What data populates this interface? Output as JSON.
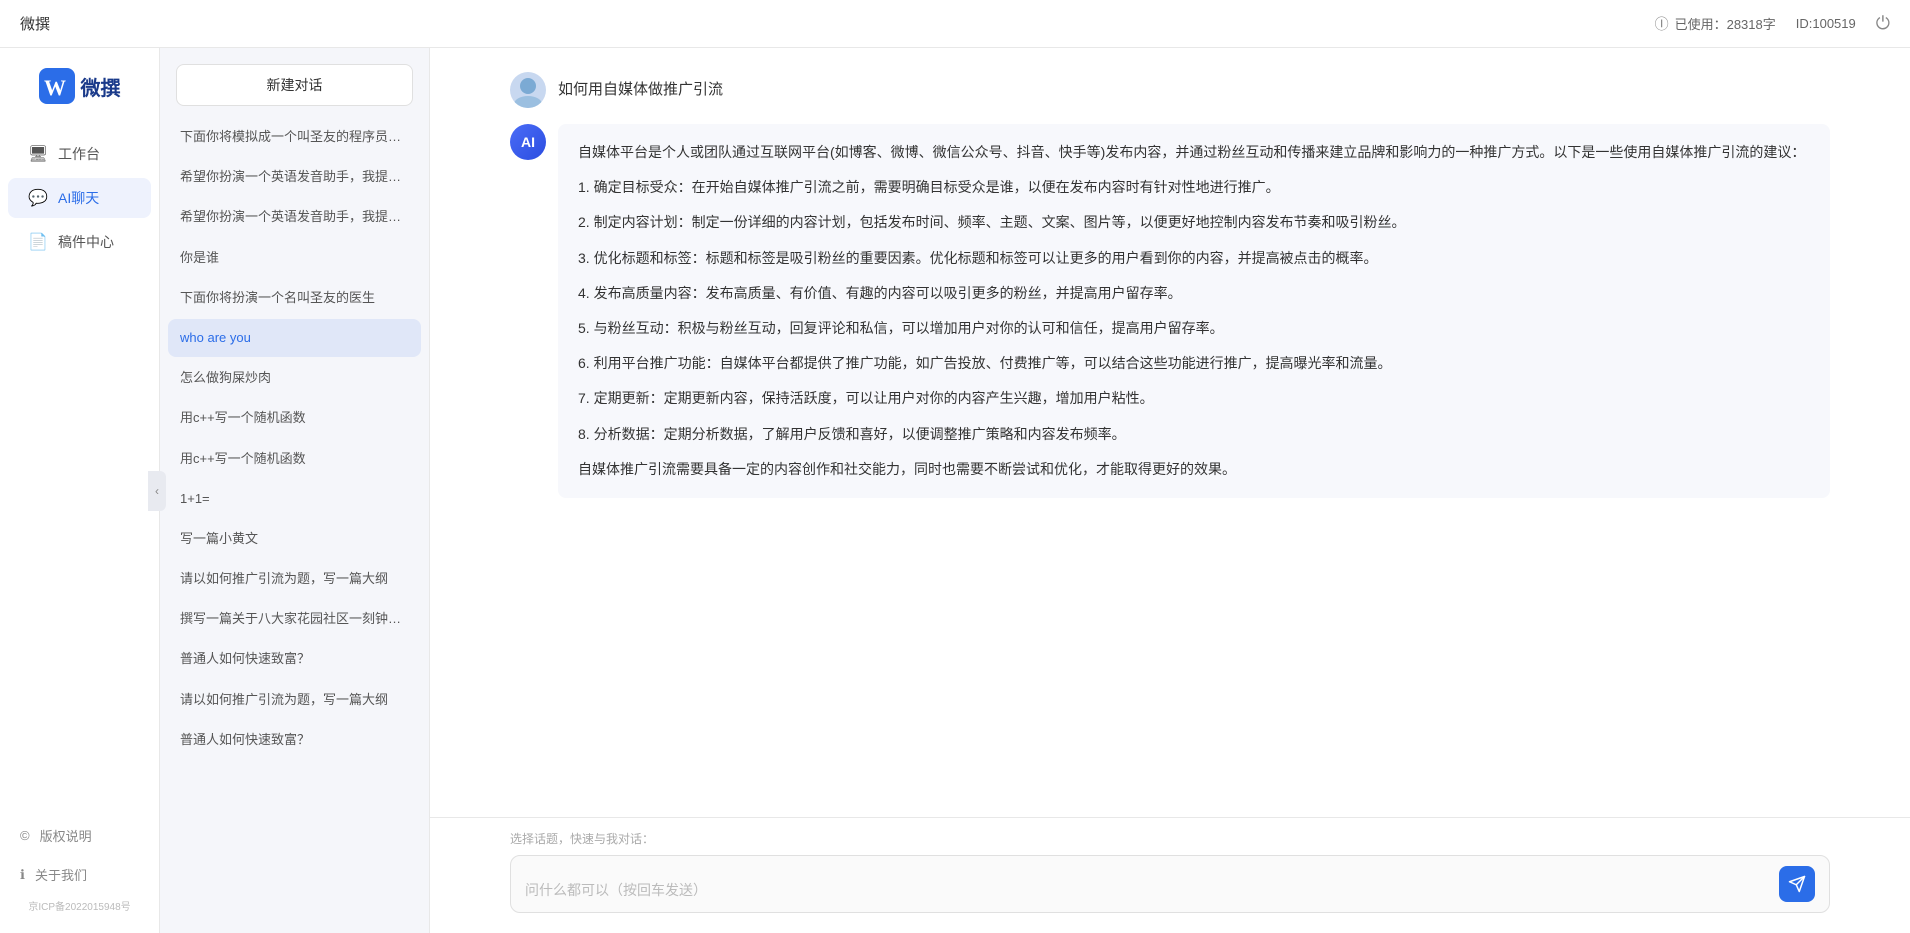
{
  "topbar": {
    "title": "微撰",
    "usage_label": "已使用：28318字",
    "id_label": "ID:100519",
    "logout_icon": "⏻"
  },
  "sidebar": {
    "logo_text": "微撰",
    "nav_items": [
      {
        "id": "workbench",
        "label": "工作台",
        "icon": "🖥"
      },
      {
        "id": "ai-chat",
        "label": "AI聊天",
        "icon": "💬",
        "active": true
      },
      {
        "id": "drafts",
        "label": "稿件中心",
        "icon": "📄"
      }
    ],
    "bottom_items": [
      {
        "id": "copyright",
        "label": "版权说明",
        "icon": "©"
      },
      {
        "id": "about",
        "label": "关于我们",
        "icon": "ℹ"
      }
    ],
    "icp": "京ICP备2022015948号"
  },
  "chat_list": {
    "new_chat_label": "新建对话",
    "items": [
      {
        "id": "c1",
        "text": "下面你将模拟成一个叫圣友的程序员，我说..."
      },
      {
        "id": "c2",
        "text": "希望你扮演一个英语发音助手，我提供给你..."
      },
      {
        "id": "c3",
        "text": "希望你扮演一个英语发音助手，我提供给你..."
      },
      {
        "id": "c4",
        "text": "你是谁"
      },
      {
        "id": "c5",
        "text": "下面你将扮演一个名叫圣友的医生"
      },
      {
        "id": "c6",
        "text": "who are you",
        "active": true
      },
      {
        "id": "c7",
        "text": "怎么做狗屎炒肉"
      },
      {
        "id": "c8",
        "text": "用c++写一个随机函数"
      },
      {
        "id": "c9",
        "text": "用c++写一个随机函数"
      },
      {
        "id": "c10",
        "text": "1+1="
      },
      {
        "id": "c11",
        "text": "写一篇小黄文"
      },
      {
        "id": "c12",
        "text": "请以如何推广引流为题，写一篇大纲"
      },
      {
        "id": "c13",
        "text": "撰写一篇关于八大家花园社区一刻钟便民生..."
      },
      {
        "id": "c14",
        "text": "普通人如何快速致富？"
      },
      {
        "id": "c15",
        "text": "请以如何推广引流为题，写一篇大纲"
      },
      {
        "id": "c16",
        "text": "普通人如何快速致富？"
      }
    ]
  },
  "chat": {
    "user_message": "如何用自媒体做推广引流",
    "ai_response_paragraphs": [
      "自媒体平台是个人或团队通过互联网平台(如博客、微博、微信公众号、抖音、快手等)发布内容，并通过粉丝互动和传播来建立品牌和影响力的一种推广方式。以下是一些使用自媒体推广引流的建议：",
      "1. 确定目标受众：在开始自媒体推广引流之前，需要明确目标受众是谁，以便在发布内容时有针对性地进行推广。",
      "2. 制定内容计划：制定一份详细的内容计划，包括发布时间、频率、主题、文案、图片等，以便更好地控制内容发布节奏和吸引粉丝。",
      "3. 优化标题和标签：标题和标签是吸引粉丝的重要因素。优化标题和标签可以让更多的用户看到你的内容，并提高被点击的概率。",
      "4. 发布高质量内容：发布高质量、有价值、有趣的内容可以吸引更多的粉丝，并提高用户留存率。",
      "5. 与粉丝互动：积极与粉丝互动，回复评论和私信，可以增加用户对你的认可和信任，提高用户留存率。",
      "6. 利用平台推广功能：自媒体平台都提供了推广功能，如广告投放、付费推广等，可以结合这些功能进行推广，提高曝光率和流量。",
      "7. 定期更新：定期更新内容，保持活跃度，可以让用户对你的内容产生兴趣，增加用户粘性。",
      "8. 分析数据：定期分析数据，了解用户反馈和喜好，以便调整推广策略和内容发布频率。",
      "自媒体推广引流需要具备一定的内容创作和社交能力，同时也需要不断尝试和优化，才能取得更好的效果。"
    ],
    "input_placeholder": "问什么都可以（按回车发送）",
    "quick_topics_label": "选择话题，快速与我对话："
  }
}
